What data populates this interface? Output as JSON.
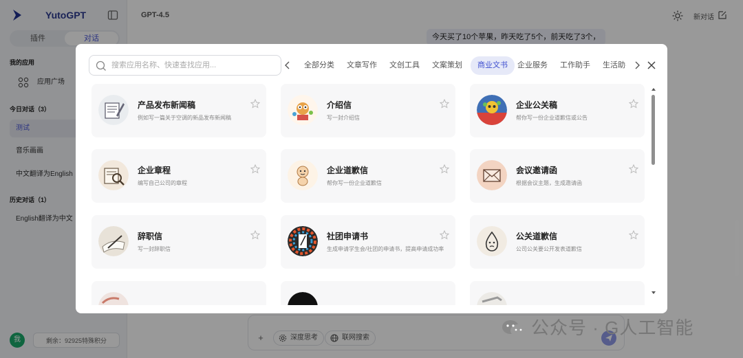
{
  "app": {
    "name": "YutoGPT",
    "model": "GPT-4.5",
    "new_chat_label": "新对话"
  },
  "sidebar": {
    "tabs": [
      "插件",
      "对话"
    ],
    "active_tab": "对话",
    "my_apps_title": "我的应用",
    "app_square_label": "应用广场",
    "today_title": "今日对话（3）",
    "today_items": [
      "测试",
      "音乐画画",
      "中文翻译为English"
    ],
    "history_title": "历史对话（1）",
    "history_items": [
      "English翻译为中文"
    ],
    "avatar_text": "我",
    "credit_text": "剩余：92925特殊积分"
  },
  "chat": {
    "user_message": "今天买了10个苹果，昨天吃了5个，前天吃了3个，",
    "input_chips": [
      "深度思考",
      "联网搜索"
    ]
  },
  "watermark": "公众号 · G人工智能",
  "modal": {
    "search_placeholder": "搜索应用名称、快速查找应用...",
    "categories": [
      "全部分类",
      "文章写作",
      "文创工具",
      "文案策划",
      "商业文书",
      "企业服务",
      "工作助手",
      "生活助手"
    ],
    "active_category": "商业文书",
    "cards": [
      {
        "title": "产品发布新闻稿",
        "desc": "例如写一篇关于空调的新品发布新闻稿",
        "icon": "press-release-icon"
      },
      {
        "title": "介绍信",
        "desc": "写一封介绍信",
        "icon": "intro-letter-icon"
      },
      {
        "title": "企业公关稿",
        "desc": "帮你写一份企业道歉信或公告",
        "icon": "pr-icon"
      },
      {
        "title": "企业章程",
        "desc": "编写自己公司的章程",
        "icon": "charter-icon"
      },
      {
        "title": "企业道歉信",
        "desc": "帮你写一份企业道歉信",
        "icon": "apology-icon"
      },
      {
        "title": "会议邀请函",
        "desc": "根据会议主题，生成邀请函",
        "icon": "invitation-icon"
      },
      {
        "title": "辞职信",
        "desc": "写一封辞职信",
        "icon": "resignation-icon"
      },
      {
        "title": "社团申请书",
        "desc": "生成申请学生会/社团的申请书，提高申请成功率",
        "icon": "club-application-icon"
      },
      {
        "title": "公关道歉信",
        "desc": "公司公关要公开发表道歉信",
        "icon": "pr-apology-icon"
      },
      {
        "title": "",
        "desc": "",
        "icon": "partial-card-icon"
      },
      {
        "title": "",
        "desc": "",
        "icon": "partial-card-icon"
      },
      {
        "title": "",
        "desc": "",
        "icon": "partial-card-icon"
      }
    ]
  },
  "colors": {
    "accent": "#3f4fcf",
    "brand": "#2b3990",
    "avatar": "#19a86a"
  }
}
